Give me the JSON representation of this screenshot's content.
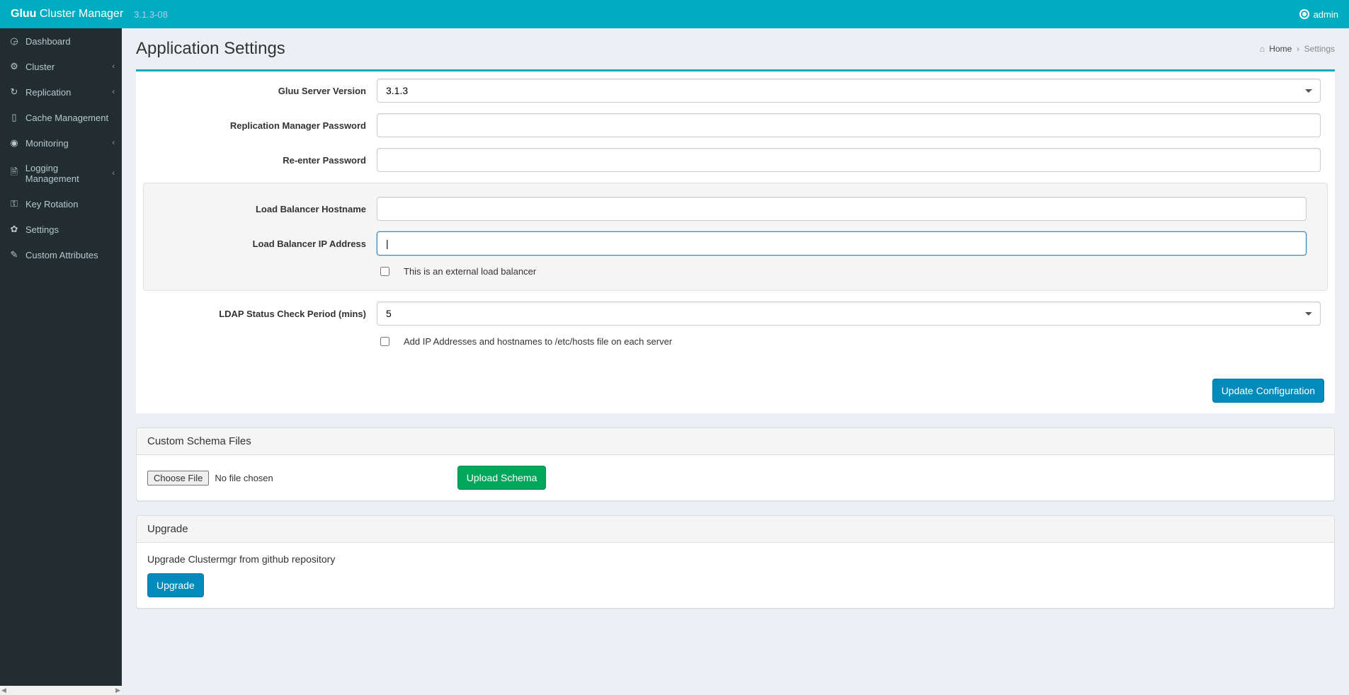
{
  "header": {
    "brand_bold": "Gluu",
    "brand_rest": " Cluster Manager",
    "version": "3.1.3-08",
    "admin": "admin"
  },
  "sidebar": {
    "items": [
      {
        "icon": "◶",
        "label": "Dashboard",
        "expandable": false
      },
      {
        "icon": "⚙",
        "label": "Cluster",
        "expandable": true
      },
      {
        "icon": "↻",
        "label": "Replication",
        "expandable": true
      },
      {
        "icon": "▯",
        "label": "Cache Management",
        "expandable": false
      },
      {
        "icon": "◉",
        "label": "Monitoring",
        "expandable": true
      },
      {
        "icon": "🗎",
        "label": "Logging Management",
        "expandable": true
      },
      {
        "icon": "⚿",
        "label": "Key Rotation",
        "expandable": false
      },
      {
        "icon": "✿",
        "label": "Settings",
        "expandable": false
      },
      {
        "icon": "✎",
        "label": "Custom Attributes",
        "expandable": false
      }
    ]
  },
  "page": {
    "title": "Application Settings",
    "crumb_home": "Home",
    "crumb_current": "Settings"
  },
  "form": {
    "labels": {
      "version": "Gluu Server Version",
      "repl_pwd": "Replication Manager Password",
      "repl_pwd2": "Re-enter Password",
      "lb_host": "Load Balancer Hostname",
      "lb_ip": "Load Balancer IP Address",
      "ext_lb": "This is an external load balancer",
      "ldap_period": "LDAP Status Check Period (mins)",
      "add_hosts": "Add IP Addresses and hostnames to /etc/hosts file on each server"
    },
    "values": {
      "version": "3.1.3",
      "ldap_period": "5",
      "ext_lb_checked": false,
      "add_hosts_checked": false,
      "lb_ip": "|"
    },
    "buttons": {
      "update": "Update Configuration"
    }
  },
  "schema_panel": {
    "title": "Custom Schema Files",
    "choose": "Choose File",
    "nofile": "No file chosen",
    "upload": "Upload Schema"
  },
  "upgrade_panel": {
    "title": "Upgrade",
    "text": "Upgrade Clustermgr from github repository",
    "btn": "Upgrade"
  }
}
